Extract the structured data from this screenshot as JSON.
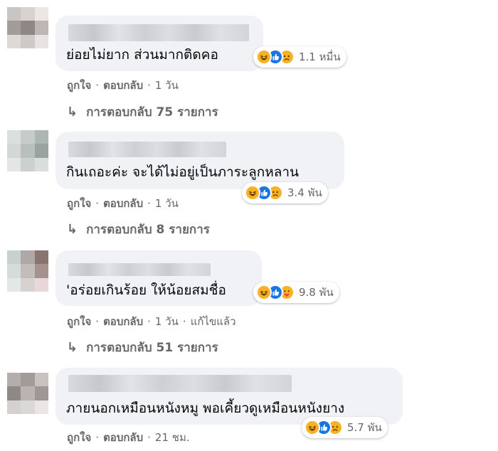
{
  "comments": [
    {
      "text": "ย่อยไม่ยาก ส่วนมากติดคอ",
      "reaction_count": "1.1 หมื่น",
      "actions": {
        "like": "ถูกใจ",
        "reply": "ตอบกลับ",
        "time": "1 วัน",
        "edited": ""
      },
      "replies": "การตอบกลับ 75 รายการ",
      "reactions": [
        "haha-icon",
        "like-icon",
        "sad-icon"
      ]
    },
    {
      "text": "กินเถอะค่ะ จะได้ไม่อยู่เป็นภาระลูกหลาน",
      "reaction_count": "3.4 พัน",
      "actions": {
        "like": "ถูกใจ",
        "reply": "ตอบกลับ",
        "time": "1 วัน",
        "edited": ""
      },
      "replies": "การตอบกลับ 8 รายการ",
      "reactions": [
        "haha-icon",
        "like-icon",
        "sad-icon"
      ]
    },
    {
      "text": "'อร่อยเกินร้อย ให้น้อยสมชื่อ",
      "reaction_count": "9.8 พัน",
      "actions": {
        "like": "ถูกใจ",
        "reply": "ตอบกลับ",
        "time": "1 วัน",
        "edited": "แก้ไขแล้ว"
      },
      "replies": "การตอบกลับ 51 รายการ",
      "reactions": [
        "haha-icon",
        "like-icon",
        "care-icon"
      ]
    },
    {
      "text": "ภายนอกเหมือนหนังหมู พอเคี้ยวดูเหมือนหนังยาง",
      "reaction_count": "5.7 พัน",
      "actions": {
        "like": "ถูกใจ",
        "reply": "ตอบกลับ",
        "time": "21 ชม.",
        "edited": ""
      },
      "replies": "",
      "reactions": [
        "haha-icon",
        "like-icon",
        "sad-icon"
      ]
    }
  ],
  "colors": {
    "bubble": "#f0f2f5",
    "meta_text": "#65676b",
    "like_blue": "#1b74e4",
    "emoji_yellow": "#f7b125"
  }
}
